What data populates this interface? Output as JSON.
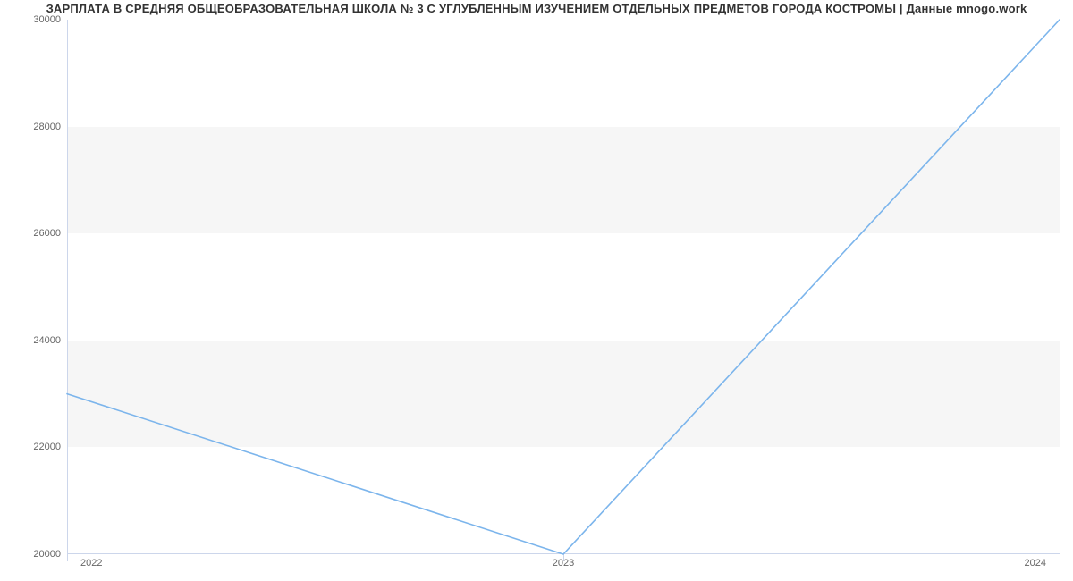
{
  "chart_data": {
    "type": "line",
    "title": "ЗАРПЛАТА В СРЕДНЯЯ ОБЩЕОБРАЗОВАТЕЛЬНАЯ ШКОЛА № 3 С УГЛУБЛЕННЫМ ИЗУЧЕНИЕМ ОТДЕЛЬНЫХ ПРЕДМЕТОВ ГОРОДА КОСТРОМЫ | Данные mnogo.work",
    "xlabel": "",
    "ylabel": "",
    "categories": [
      "2022",
      "2023",
      "2024"
    ],
    "x": [
      2022,
      2023,
      2024
    ],
    "values": [
      23000,
      20000,
      30000
    ],
    "ylim": [
      20000,
      30000
    ],
    "y_ticks": [
      20000,
      22000,
      24000,
      26000,
      28000,
      30000
    ],
    "x_ticks": [
      "2022",
      "2023",
      "2024"
    ],
    "line_color": "#7cb5ec",
    "band_color": "#f6f6f6"
  }
}
